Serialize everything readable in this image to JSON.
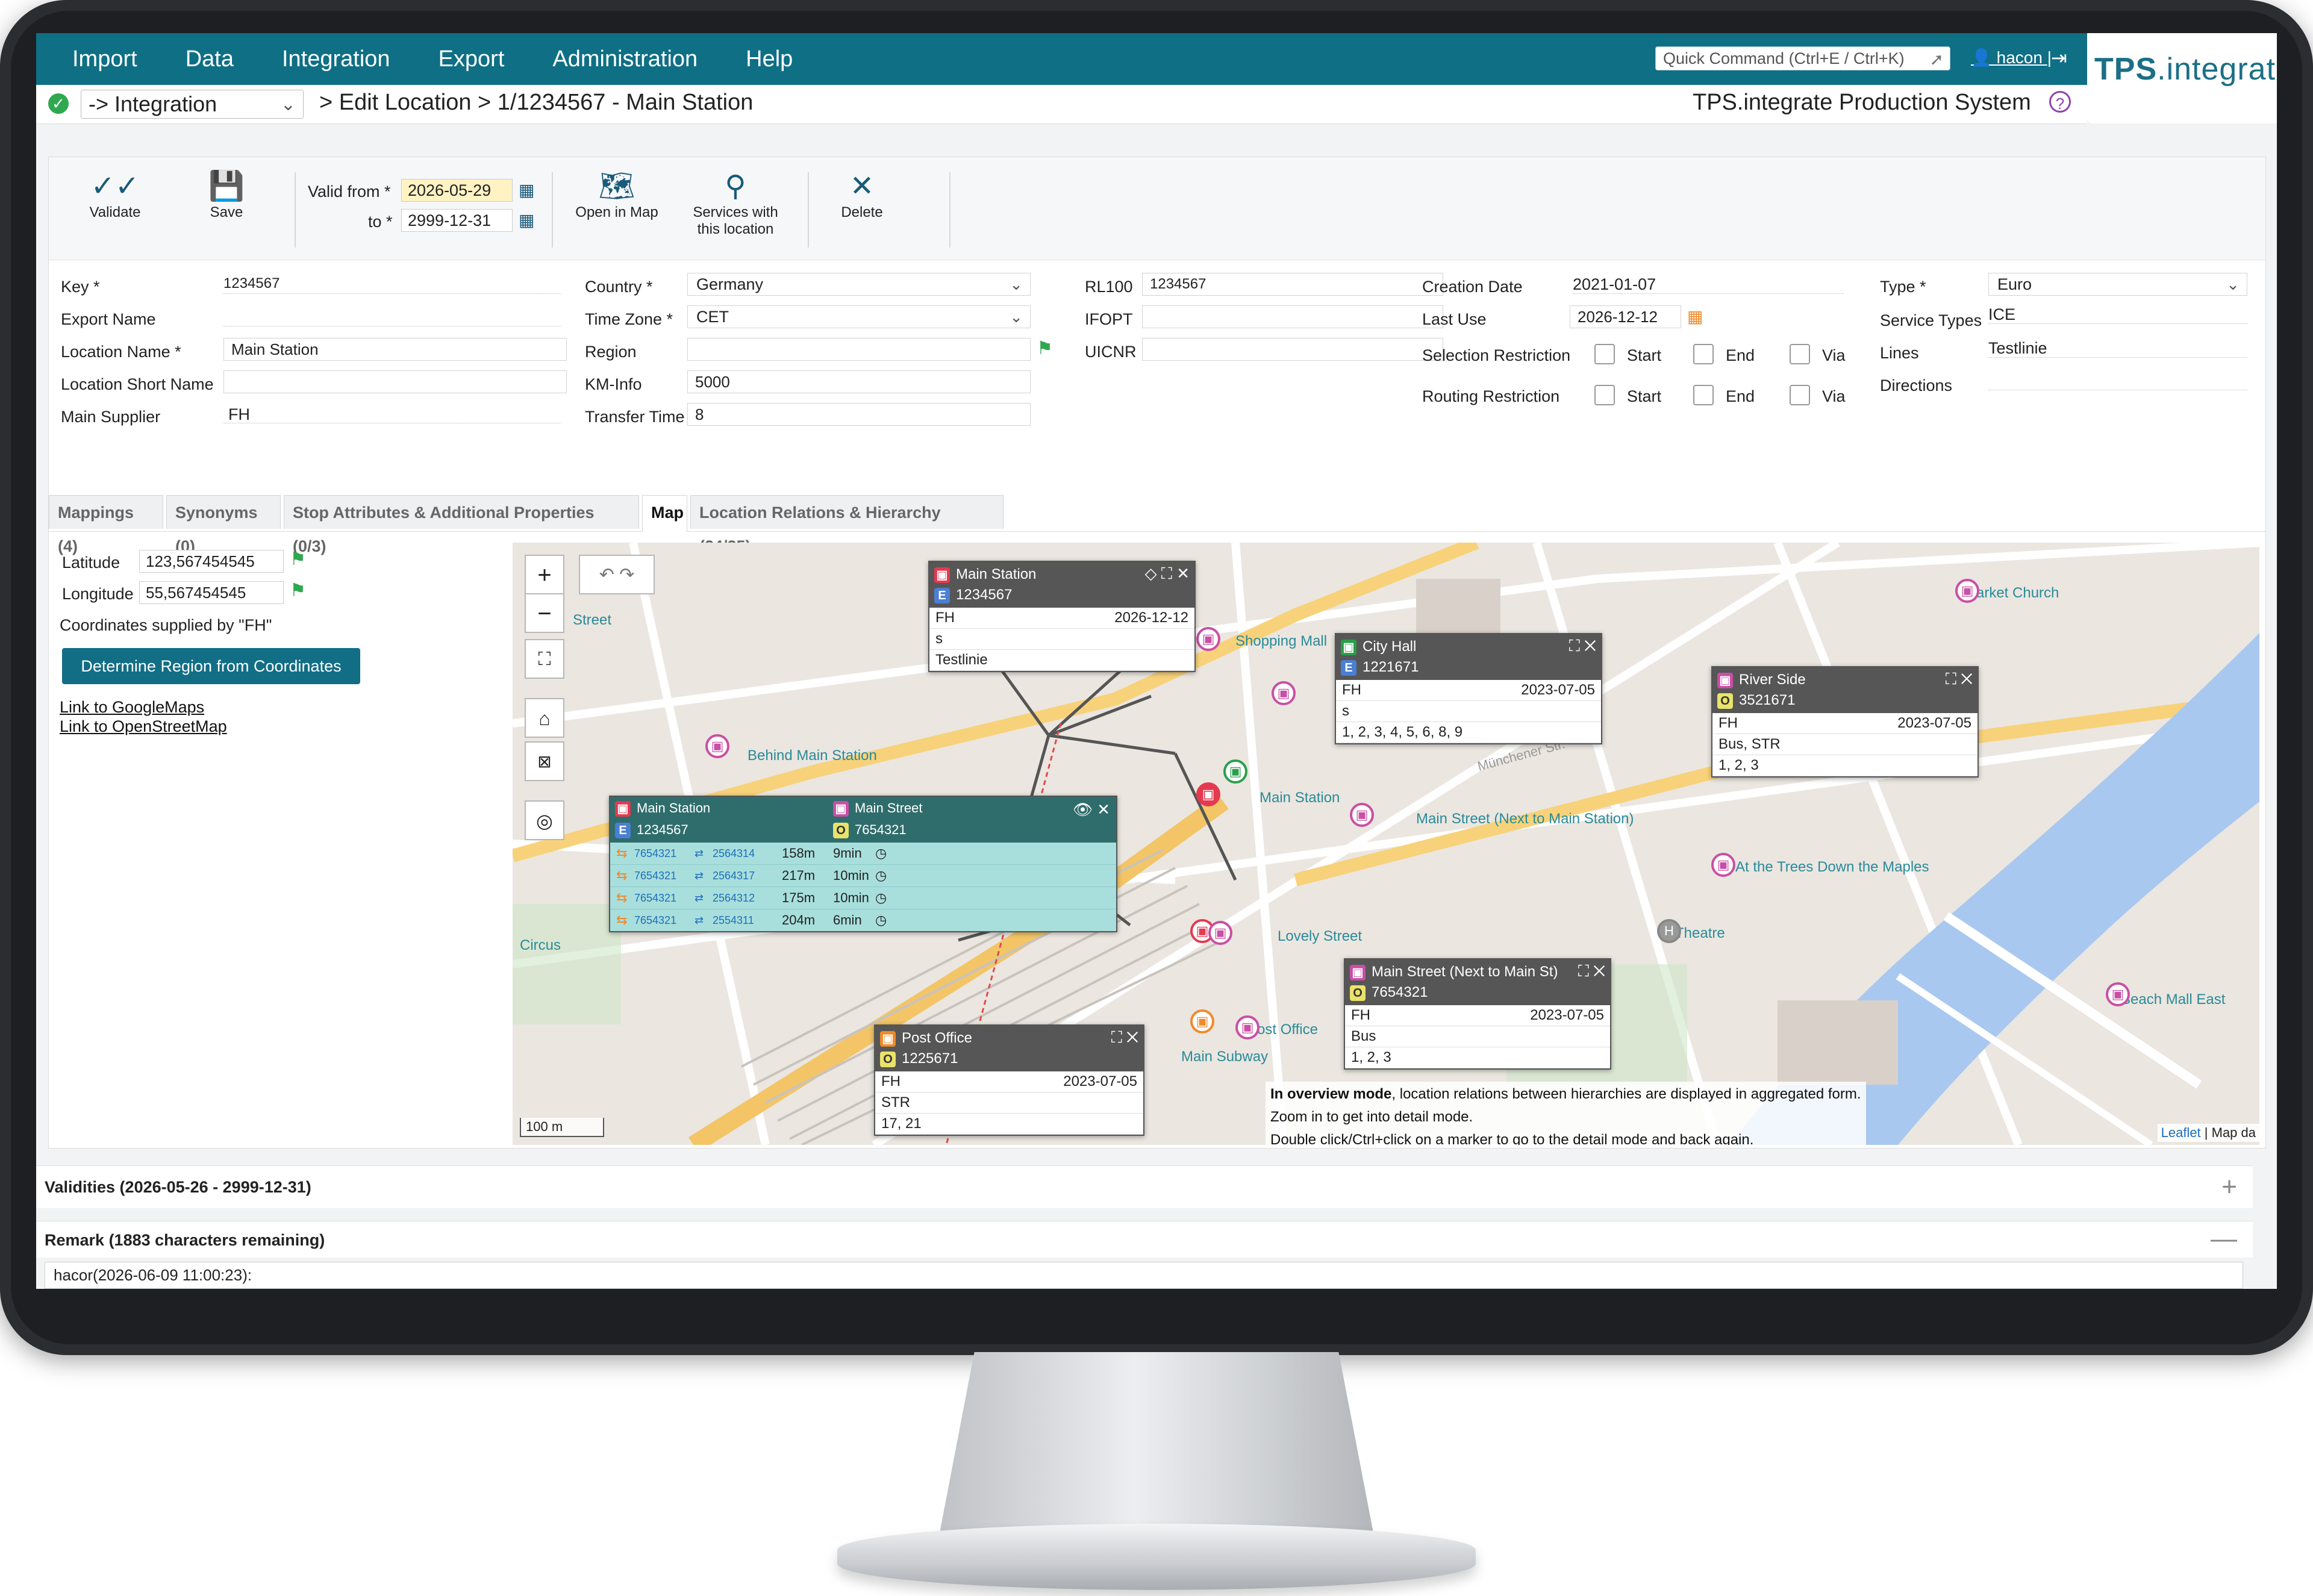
{
  "menu": [
    "Import",
    "Data",
    "Integration",
    "Export",
    "Administration",
    "Help"
  ],
  "quick_command": {
    "placeholder": "Quick Command (Ctrl+E / Ctrl+K)"
  },
  "user": "hacon",
  "user_sep": "|",
  "logo": {
    "part1": "TPS",
    "part2": ".integrate"
  },
  "breadcrumb": {
    "selector": "-> Integration",
    "path": "> Edit Location > 1/1234567 - Main Station"
  },
  "system_name": "TPS.integrate Production System",
  "toolbar": {
    "validate": "Validate",
    "save": "Save",
    "valid_from_label": "Valid from *",
    "valid_from": "2026-05-29",
    "to_label": "to *",
    "to": "2999-12-31",
    "open_map": "Open in Map",
    "services_1": "Services with",
    "services_2": "this location",
    "delete": "Delete"
  },
  "form": {
    "key_label": "Key *",
    "key": "1234567",
    "export_name_label": "Export Name",
    "location_name_label": "Location Name *",
    "location_name": "Main Station",
    "short_name_label": "Location Short Name",
    "main_supplier_label": "Main Supplier",
    "main_supplier": "FH",
    "country_label": "Country *",
    "country": "Germany",
    "time_zone_label": "Time Zone *",
    "time_zone": "CET",
    "region_label": "Region",
    "km_info_label": "KM-Info",
    "km_info": "5000",
    "transfer_time_label": "Transfer Time",
    "transfer_time": "8",
    "rl100_label": "RL100",
    "rl100": "1234567",
    "ifopt_label": "IFOPT",
    "uicnr_label": "UICNR",
    "creation_date_label": "Creation Date",
    "creation_date": "2021-01-07",
    "last_use_label": "Last Use",
    "last_use": "2026-12-12",
    "selection_restriction_label": "Selection Restriction",
    "routing_restriction_label": "Routing Restriction",
    "start": "Start",
    "end": "End",
    "via": "Via",
    "type_label": "Type *",
    "type": "Euro",
    "service_types_label": "Service Types",
    "service_types": "ICE",
    "lines_label": "Lines",
    "lines": "Testlinie",
    "directions_label": "Directions"
  },
  "tabs": [
    "Mappings (4)",
    "Synonyms (0)",
    "Stop Attributes & Additional Properties (0/3)",
    "Map",
    "Location Relations & Hierarchy (24/25)"
  ],
  "coords": {
    "lat_label": "Latitude",
    "lat": "123,567454545",
    "lon_label": "Longitude",
    "lon": "55,567454545",
    "supplied": "Coordinates supplied by \"FH\"",
    "determine_btn": "Determine Region from Coordinates",
    "google": "Link to GoogleMaps",
    "osm": "Link to OpenStreetMap"
  },
  "map": {
    "places": [
      "Street",
      "Shopping Mall",
      "Market Church",
      "Behind Main Station",
      "Main Station",
      "Main Street (Next to Main Station)",
      "At the Trees Down the Maples",
      "Circus",
      "Lovely Street",
      "Theatre",
      "Post Office",
      "Main Subway",
      "Beach Mall East",
      "Münchener Str."
    ],
    "popup_main": {
      "name": "Main Station",
      "id": "1234567",
      "supplier": "FH",
      "date": "2026-12-12",
      "s": "s",
      "line": "Testlinie"
    },
    "popup_cityhall": {
      "name": "City Hall",
      "id": "1221671",
      "supplier": "FH",
      "date": "2023-07-05",
      "s": "s",
      "lines": "1, 2, 3, 4, 5, 6, 8, 9"
    },
    "popup_river": {
      "name": "River Side",
      "id": "3521671",
      "supplier": "FH",
      "date": "2023-07-05",
      "modes": "Bus, STR",
      "lines": "1, 2, 3"
    },
    "popup_mainst": {
      "name": "Main Street (Next to Main St)",
      "id": "7654321",
      "supplier": "FH",
      "date": "2023-07-05",
      "mode": "Bus",
      "lines": "1, 2, 3"
    },
    "popup_post": {
      "name": "Post Office",
      "id": "1225671",
      "supplier": "FH",
      "date": "2023-07-05",
      "mode": "STR",
      "lines": "17, 21"
    },
    "relation": {
      "from_name": "Main Station",
      "from_id": "1234567",
      "to_name": "Main Street",
      "to_id": "7654321",
      "rows": [
        {
          "a": "7654321",
          "b": "2564314",
          "dist": "158m",
          "time": "9min"
        },
        {
          "a": "7654321",
          "b": "2564317",
          "dist": "217m",
          "time": "10min"
        },
        {
          "a": "7654321",
          "b": "2564312",
          "dist": "175m",
          "time": "10min"
        },
        {
          "a": "7654321",
          "b": "2554311",
          "dist": "204m",
          "time": "6min"
        }
      ]
    },
    "info_bold": "In overview mode",
    "info_1": ", location relations between hierarchies are displayed in aggregated form.",
    "info_2": "Zoom in to get into detail mode.",
    "info_3": "Double click/Ctrl+click on a marker to go to the detail mode and back again.",
    "scale": "100 m",
    "attribution_link": "Leaflet",
    "attribution_rest": " | Map da"
  },
  "validities": "Validities (2026-05-26 - 2999-12-31)",
  "remark": "Remark (1883 characters remaining)",
  "remark_text": "hacor(2026-06-09 11:00:23):"
}
